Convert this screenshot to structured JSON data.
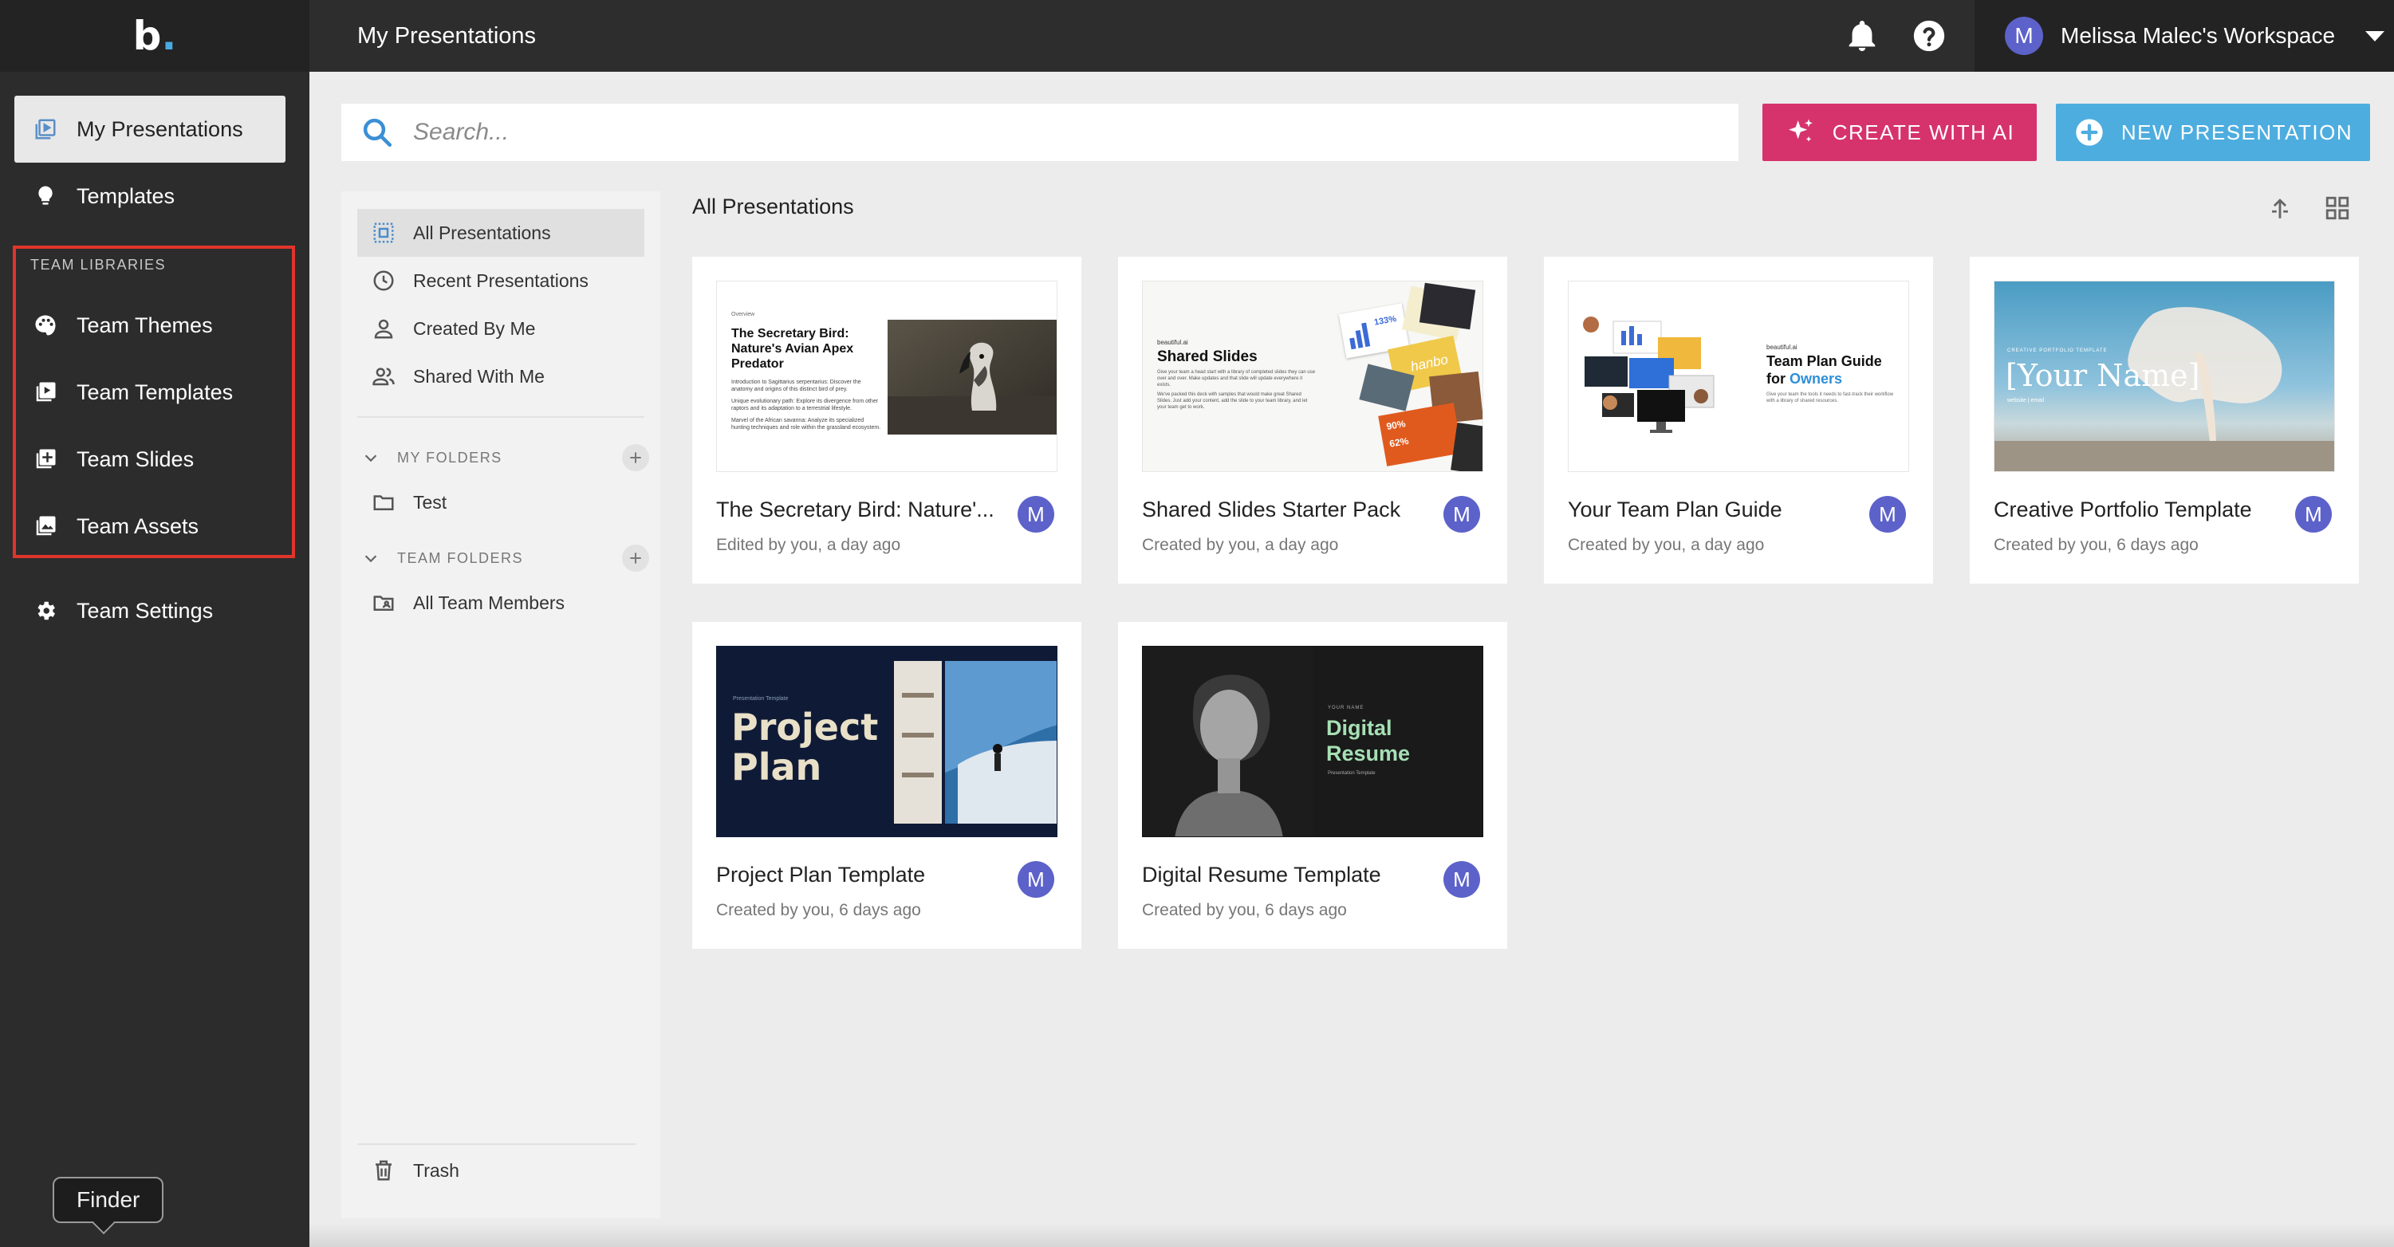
{
  "app": {
    "logo": "b",
    "page_title": "My Presentations",
    "workspace_name": "Melissa Malec's Workspace",
    "user_initial": "M"
  },
  "sidebar": {
    "items": [
      {
        "label": "My Presentations",
        "icon": "presentation-icon"
      },
      {
        "label": "Templates",
        "icon": "lightbulb-icon"
      }
    ],
    "team_heading": "TEAM LIBRARIES",
    "team_items": [
      {
        "label": "Team Themes",
        "icon": "palette-icon"
      },
      {
        "label": "Team Templates",
        "icon": "play-square-icon"
      },
      {
        "label": "Team Slides",
        "icon": "add-slide-icon"
      },
      {
        "label": "Team Assets",
        "icon": "image-icon"
      }
    ],
    "settings_label": "Team Settings",
    "tooltip": "Finder"
  },
  "search": {
    "placeholder": "Search..."
  },
  "buttons": {
    "create_ai": "CREATE WITH AI",
    "new_presentation": "NEW PRESENTATION"
  },
  "folders": {
    "filters": [
      {
        "label": "All Presentations",
        "icon": "dotted-square-icon"
      },
      {
        "label": "Recent Presentations",
        "icon": "clock-icon"
      },
      {
        "label": "Created By Me",
        "icon": "person-icon"
      },
      {
        "label": "Shared With Me",
        "icon": "people-icon"
      }
    ],
    "my_folders_heading": "MY FOLDERS",
    "my_folders": [
      {
        "label": "Test"
      }
    ],
    "team_folders_heading": "TEAM FOLDERS",
    "team_folders": [
      {
        "label": "All Team Members"
      }
    ],
    "trash_label": "Trash"
  },
  "main": {
    "section_title": "All Presentations",
    "cards": [
      {
        "title": "The Secretary Bird: Nature'...",
        "subtitle": "Edited by you, a day ago",
        "thumb": {
          "overview": "Overview",
          "heading": "The Secretary Bird: Nature's Avian Apex Predator",
          "bullet1": "Introduction to Sagittarius serpentarius: Discover the anatomy and origins of this distinct bird of prey.",
          "bullet2": "Unique evolutionary path: Explore its divergence from other raptors and its adaptation to a terrestrial lifestyle.",
          "bullet3": "Marvel of the African savanna: Analyze its specialized hunting techniques and role within the grassland ecosystem."
        }
      },
      {
        "title": "Shared Slides Starter Pack",
        "subtitle": "Created by you, a day ago",
        "thumb": {
          "brand": "beautiful.ai",
          "heading": "Shared Slides",
          "body": "Give your team a head start with a library of completed slides they can use over and over. Make updates and that slide will update everywhere it exists.",
          "body2": "We've packed this deck with samples that would make great Shared Slides. Just add your content, add the slide to your team library, and let your team get to work.",
          "stat1": "133%",
          "stat2": "90%",
          "stat3": "62%",
          "word": "hanbo"
        }
      },
      {
        "title": "Your Team Plan Guide",
        "subtitle": "Created by you, a day ago",
        "thumb": {
          "brand": "beautiful.ai",
          "heading": "Team Plan Guide",
          "heading2": "for",
          "accent": "Owners",
          "body": "Give your team the tools it needs to fast-track their workflow with a library of shared resources."
        }
      },
      {
        "title": "Creative Portfolio Template",
        "subtitle": "Created by you, 6 days ago",
        "thumb": {
          "kicker": "CREATIVE PORTFOLIO TEMPLATE",
          "name": "[Your Name]",
          "site": "website | email"
        }
      },
      {
        "title": "Project Plan Template",
        "subtitle": "Created by you, 6 days ago",
        "thumb": {
          "kicker": "Presentation Template",
          "line1": "Project",
          "line2": "Plan"
        }
      },
      {
        "title": "Digital Resume Template",
        "subtitle": "Created by you, 6 days ago",
        "thumb": {
          "kicker": "YOUR NAME",
          "line1": "Digital",
          "line2": "Resume",
          "sub": "Presentation Template"
        }
      }
    ]
  },
  "colors": {
    "accent_ai": "#d6336c",
    "accent_new": "#4eaddf",
    "avatar": "#5c62c9",
    "highlight": "#e0352b"
  }
}
